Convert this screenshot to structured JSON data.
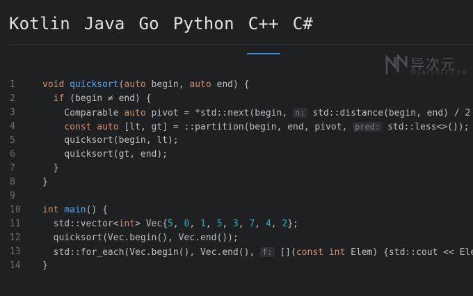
{
  "tabs": [
    "Kotlin",
    "Java",
    "Go",
    "Python",
    "C++",
    "C#"
  ],
  "active_tab": "C++",
  "watermark": {
    "title": "异次元",
    "subtitle": "IPLAYSOFT.COM"
  },
  "code": {
    "line_numbers": [
      "1",
      "2",
      "3",
      "4",
      "5",
      "6",
      "7",
      "8",
      "9",
      "10",
      "11",
      "12",
      "13",
      "14"
    ],
    "l1": {
      "a": "void ",
      "b": "quicksort",
      "c": "(",
      "d": "auto",
      "e": " begin, ",
      "f": "auto",
      "g": " end) {"
    },
    "l2": {
      "a": "  ",
      "b": "if",
      "c": " (begin ≠ end) {"
    },
    "l3": {
      "a": "    Comparable ",
      "b": "auto",
      "c": " pivot = *std::next(begin, ",
      "hint": "n:",
      "d": " std::distance(begin, end) / 2"
    },
    "l4": {
      "a": "    ",
      "b": "const auto",
      "c": " [lt, gt] = ::partition(begin, end, pivot, ",
      "hint": "pred:",
      "d": " std::less<>());"
    },
    "l5": {
      "a": "    quicksort(begin, lt);"
    },
    "l6": {
      "a": "    quicksort(gt, end);"
    },
    "l7": {
      "a": "  }"
    },
    "l8": {
      "a": "}"
    },
    "l10": {
      "a": "int",
      "b": " main",
      "c": "() {"
    },
    "l11": {
      "a": "  std::vector<",
      "b": "int",
      "c": "> Vec{",
      "n1": "5",
      "s1": ", ",
      "n2": "0",
      "s2": ", ",
      "n3": "1",
      "s3": ", ",
      "n4": "5",
      "s4": ", ",
      "n5": "3",
      "s5": ", ",
      "n6": "7",
      "s6": ", ",
      "n7": "4",
      "s7": ", ",
      "n8": "2",
      "e": "};"
    },
    "l12": {
      "a": "  quicksort(Vec.begin(), Vec.end());"
    },
    "l13": {
      "a": "  std::for_each(Vec.begin(), Vec.end(), ",
      "hint": "f:",
      "b": " [](",
      "c": "const int",
      "d": " Elem) {std::cout << Ele"
    },
    "l14": {
      "a": "}"
    }
  }
}
